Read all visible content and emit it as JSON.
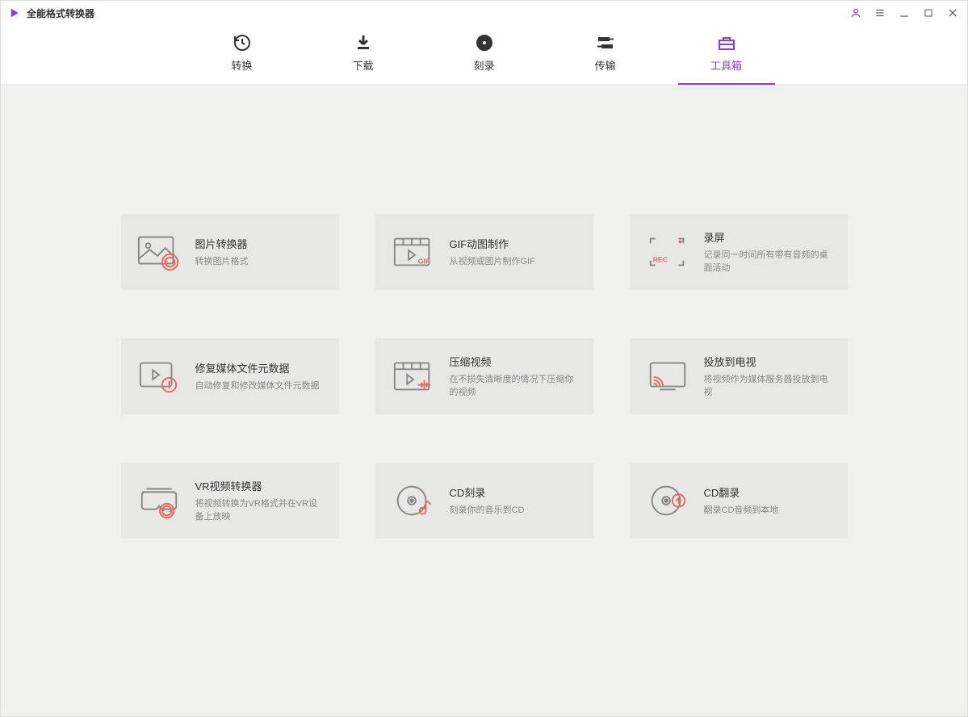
{
  "app": {
    "title": "全能格式转换器"
  },
  "tabs": [
    {
      "id": "convert",
      "label": "转换"
    },
    {
      "id": "download",
      "label": "下载"
    },
    {
      "id": "burn",
      "label": "刻录"
    },
    {
      "id": "transfer",
      "label": "传输"
    },
    {
      "id": "toolbox",
      "label": "工具箱"
    }
  ],
  "tools": [
    {
      "id": "image-converter",
      "title": "图片转换器",
      "desc": "转换图片格式"
    },
    {
      "id": "gif-maker",
      "title": "GIF动图制作",
      "desc": "从视频或图片制作GIF"
    },
    {
      "id": "screen-recorder",
      "title": "录屏",
      "desc": "记录同一时间所有带有音频的桌面活动"
    },
    {
      "id": "fix-metadata",
      "title": "修复媒体文件元数据",
      "desc": "自动修复和修改媒体文件元数据"
    },
    {
      "id": "compress-video",
      "title": "压缩视频",
      "desc": "在不损失清晰度的情况下压缩你的视频"
    },
    {
      "id": "cast-to-tv",
      "title": "投放到电视",
      "desc": "将视频作为媒体服务器投放到电视"
    },
    {
      "id": "vr-converter",
      "title": "VR视频转换器",
      "desc": "将视频转换为VR格式并在VR设备上放映"
    },
    {
      "id": "cd-burner",
      "title": "CD刻录",
      "desc": "刻录你的音乐到CD"
    },
    {
      "id": "cd-ripper",
      "title": "CD翻录",
      "desc": "翻录CD音频到本地"
    }
  ]
}
